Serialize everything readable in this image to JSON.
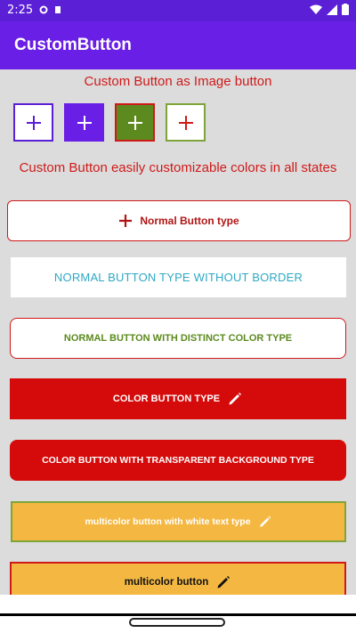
{
  "status": {
    "time": "2:25"
  },
  "app": {
    "title": "CustomButton"
  },
  "sections": {
    "image_button_title": "Custom Button as Image button",
    "customizable_title": "Custom Button easily customizable colors in all states"
  },
  "buttons": {
    "normal": "Normal Button type",
    "no_border": "NORMAL BUTTON TYPE WITHOUT BORDER",
    "distinct": "NORMAL BUTTON WITH DISTINCT COLOR TYPE",
    "color": "COLOR BUTTON TYPE",
    "transparent_bg": "COLOR BUTTON WITH TRANSPARENT BACKGROUND TYPE",
    "multicolor_white": "multicolor button with white text type",
    "multicolor": "multicolor button"
  },
  "colors": {
    "accent_red": "#d01a1a",
    "purple": "#6a1fe6",
    "green": "#5c8a1e",
    "orange": "#f4b842"
  },
  "icons": {
    "plus": "plus-icon",
    "pencil": "pencil-icon"
  }
}
